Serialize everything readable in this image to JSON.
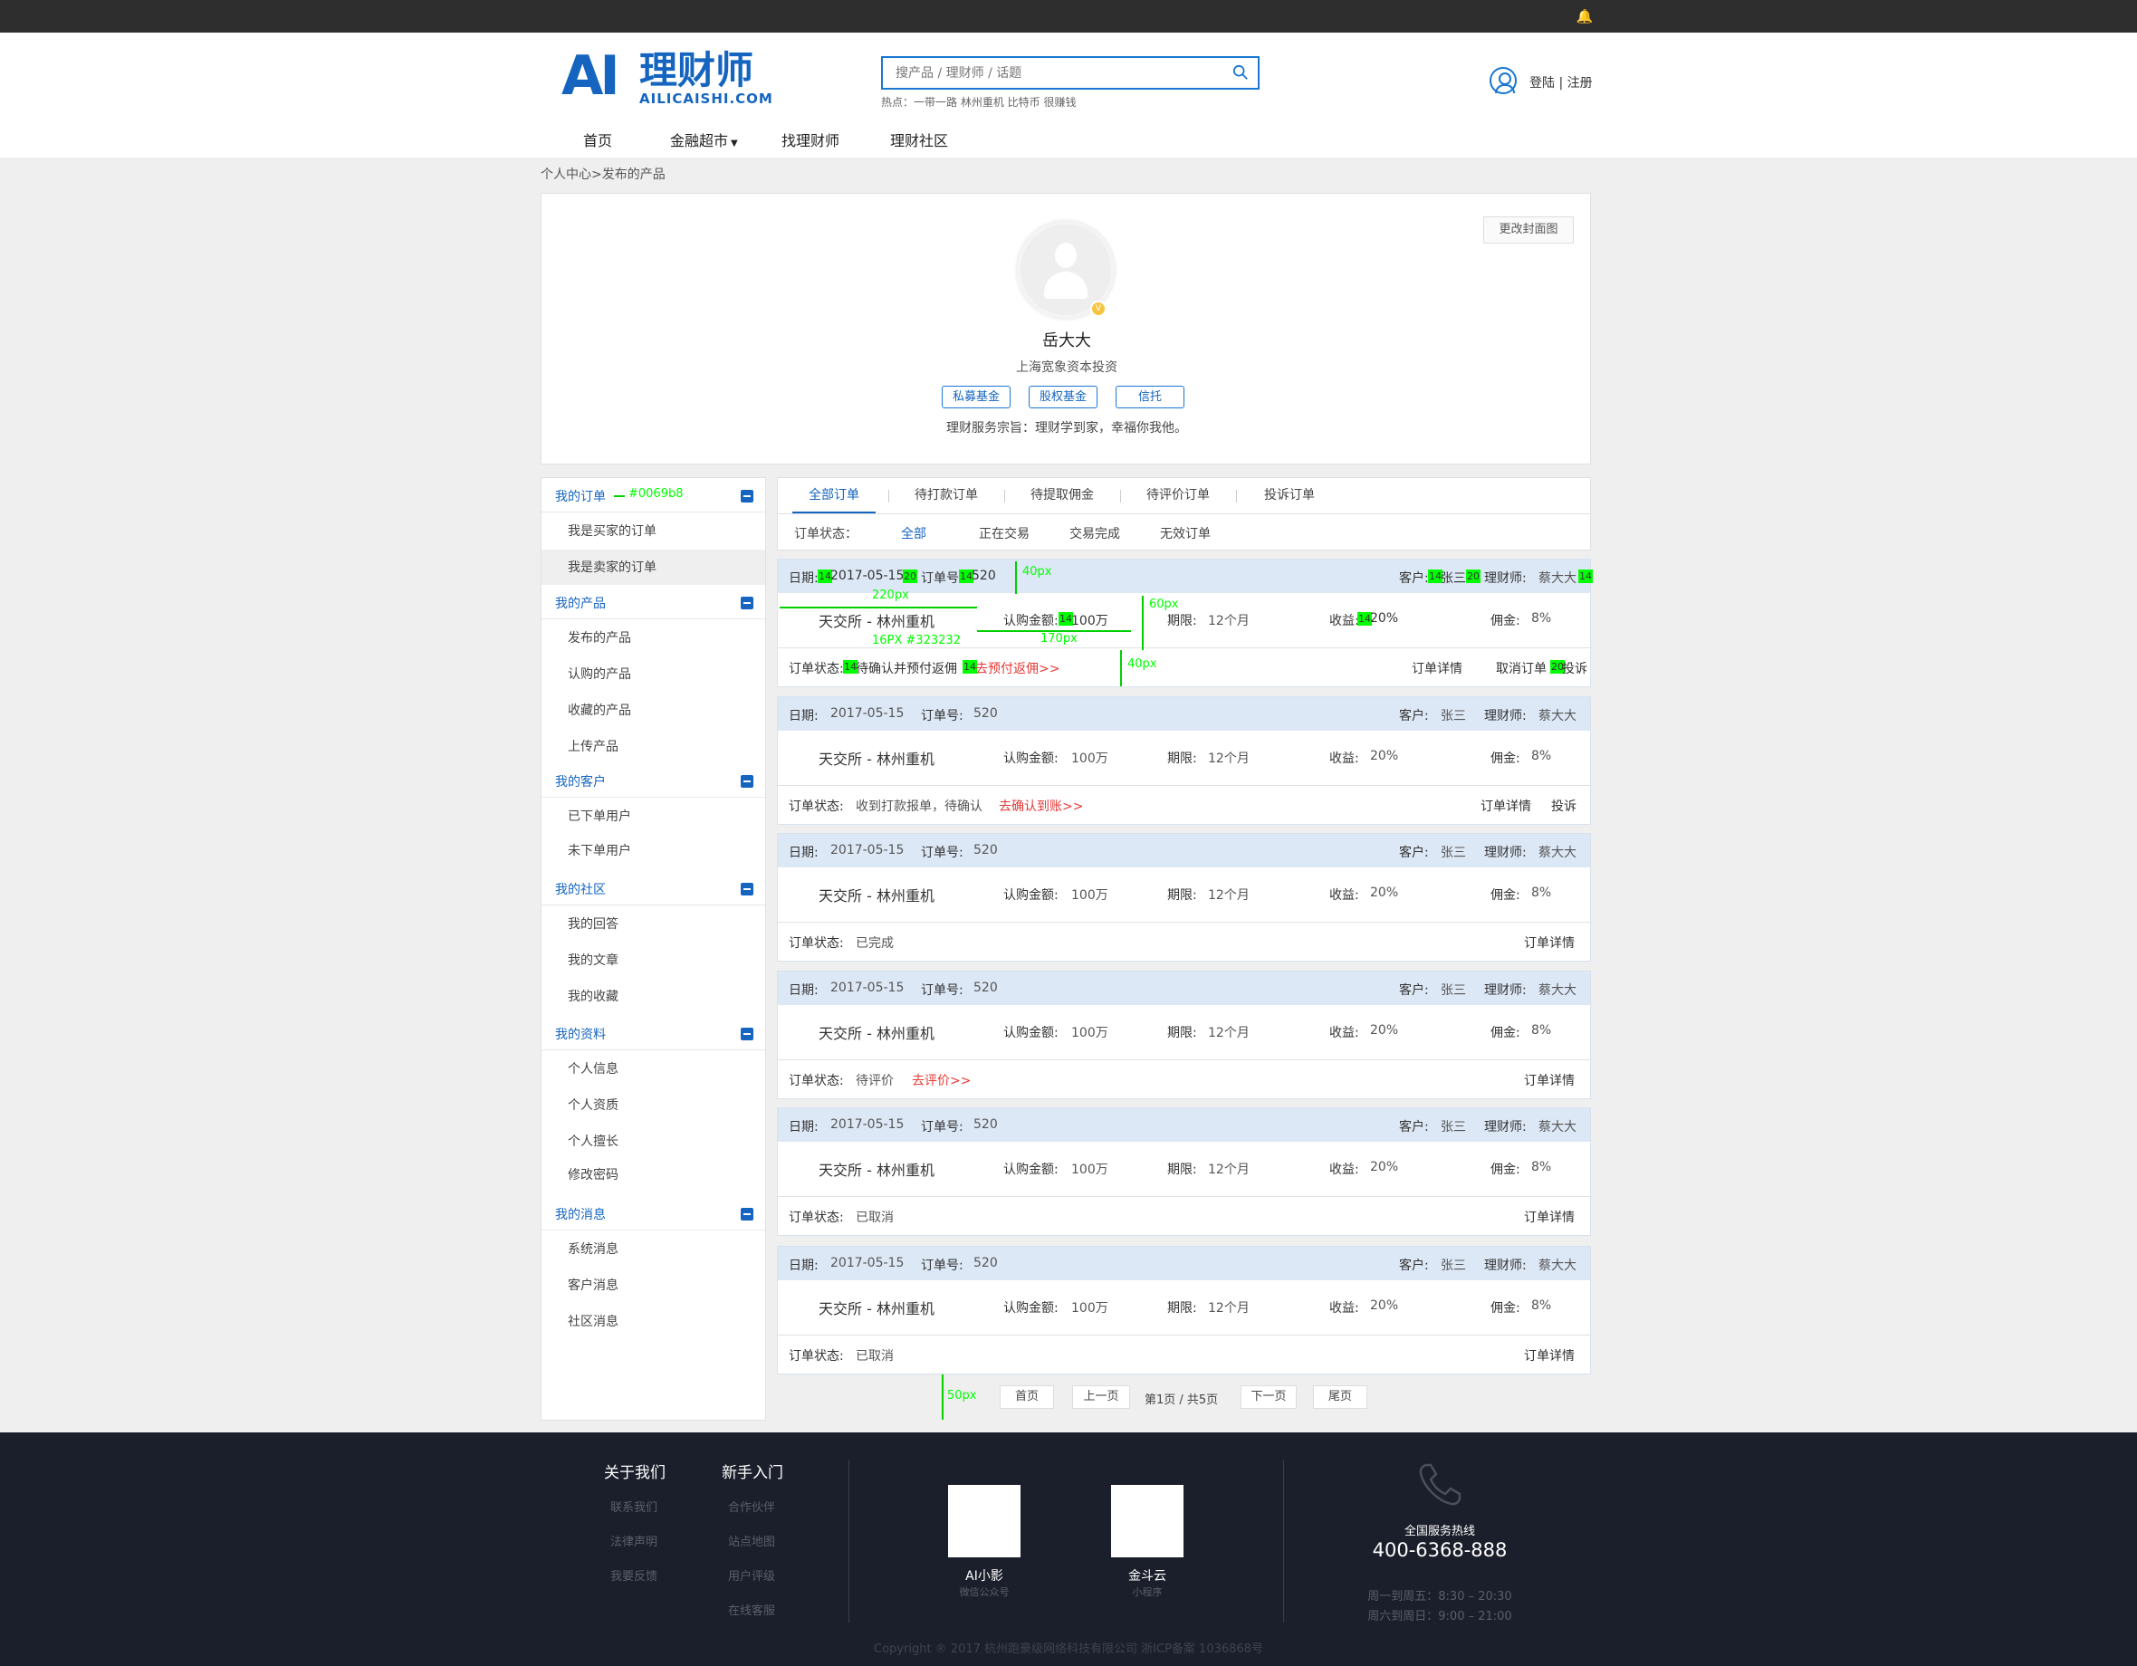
{
  "colors": {
    "brand": "#1565c0",
    "annotation": "#00ff00",
    "link_red": "#e53935",
    "order_header_bg": "#dde8f6",
    "footer_bg": "#1b1f2b"
  },
  "header": {
    "logo_ai": "AI",
    "logo_title": "理财师",
    "logo_sub": "AILICAISHI.COM",
    "search_placeholder": "搜产品 / 理财师 / 话题",
    "hot_label": "热点：一带一路 林州重机 比特币 很赚钱",
    "login": "登陆 | 注册",
    "icons": {
      "notification": "bell-icon",
      "search": "search-icon",
      "user": "user-icon"
    }
  },
  "nav": {
    "items": [
      {
        "label": "首页"
      },
      {
        "label": "金融超市"
      },
      {
        "label": "找理财师"
      },
      {
        "label": "理财社区"
      }
    ]
  },
  "breadcrumb": "个人中心>发布的产品",
  "profile": {
    "cover_button": "更改封面图",
    "name": "岳大大",
    "company": "上海宽象资本投资",
    "tags": [
      "私募基金",
      "股权基金",
      "信托"
    ],
    "motto": "理财服务宗旨：理财学到家，幸福你我他。"
  },
  "sidebar": {
    "groups": [
      {
        "title": "我的订单",
        "items": [
          "我是买家的订单",
          "我是卖家的订单"
        ]
      },
      {
        "title": "我的产品",
        "items": [
          "发布的产品",
          "认购的产品",
          "收藏的产品",
          "上传产品"
        ]
      },
      {
        "title": "我的客户",
        "items": [
          "已下单用户",
          "未下单用户"
        ]
      },
      {
        "title": "我的社区",
        "items": [
          "我的回答",
          "我的文章",
          "我的收藏"
        ]
      },
      {
        "title": "我的资料",
        "items": [
          "个人信息",
          "个人资质",
          "个人擅长",
          "修改密码"
        ]
      },
      {
        "title": "我的消息",
        "items": [
          "系统消息",
          "客户消息",
          "社区消息"
        ]
      }
    ]
  },
  "tabs": [
    "全部订单",
    "待打款订单",
    "待提取佣金",
    "待评价订单",
    "投诉订单"
  ],
  "filter": {
    "label": "订单状态：",
    "options": [
      "全部",
      "正在交易",
      "交易完成",
      "无效订单"
    ]
  },
  "order_labels": {
    "date": "日期:",
    "order_no": "订单号:",
    "customer": "客户:",
    "planner": "理财师:",
    "amount": "认购金额:",
    "term": "期限:",
    "yield": "收益:",
    "commission": "佣金:",
    "status": "订单状态:",
    "detail": "订单详情",
    "cancel": "取消订单",
    "complain": "投诉"
  },
  "orders": [
    {
      "date": "2017-05-15",
      "no": "520",
      "customer": "张三",
      "planner": "蔡大大",
      "product": "天交所 - 林州重机",
      "amount": "100万",
      "term": "12个月",
      "yield": "20%",
      "commission": "8%",
      "status": "待确认并预付返佣",
      "action": "去预付返佣>>",
      "links": [
        "订单详情",
        "取消订单",
        "投诉"
      ]
    },
    {
      "date": "2017-05-15",
      "no": "520",
      "customer": "张三",
      "planner": "蔡大大",
      "product": "天交所 - 林州重机",
      "amount": "100万",
      "term": "12个月",
      "yield": "20%",
      "commission": "8%",
      "status": "收到打款报单，待确认",
      "action": "去确认到账>>",
      "links": [
        "订单详情",
        "投诉"
      ]
    },
    {
      "date": "2017-05-15",
      "no": "520",
      "customer": "张三",
      "planner": "蔡大大",
      "product": "天交所 - 林州重机",
      "amount": "100万",
      "term": "12个月",
      "yield": "20%",
      "commission": "8%",
      "status": "已完成",
      "action": "",
      "links": [
        "订单详情"
      ]
    },
    {
      "date": "2017-05-15",
      "no": "520",
      "customer": "张三",
      "planner": "蔡大大",
      "product": "天交所 - 林州重机",
      "amount": "100万",
      "term": "12个月",
      "yield": "20%",
      "commission": "8%",
      "status": "待评价",
      "action": "去评价>>",
      "links": [
        "订单详情"
      ]
    },
    {
      "date": "2017-05-15",
      "no": "520",
      "customer": "张三",
      "planner": "蔡大大",
      "product": "天交所 - 林州重机",
      "amount": "100万",
      "term": "12个月",
      "yield": "20%",
      "commission": "8%",
      "status": "已取消",
      "action": "",
      "links": [
        "订单详情"
      ]
    },
    {
      "date": "2017-05-15",
      "no": "520",
      "customer": "张三",
      "planner": "蔡大大",
      "product": "天交所 - 林州重机",
      "amount": "100万",
      "term": "12个月",
      "yield": "20%",
      "commission": "8%",
      "status": "已取消",
      "action": "",
      "links": [
        "订单详情"
      ]
    }
  ],
  "annotations": {
    "sidebar_color": "#0069b8",
    "n14": "14",
    "n20": "20",
    "px40": "40px",
    "px220": "220px",
    "px60": "60px",
    "px16": "16PX #323232",
    "px170": "170px",
    "px50": "50px"
  },
  "pager": {
    "first": "首页",
    "prev": "上一页",
    "info": "第1页 / 共5页",
    "next": "下一页",
    "last": "尾页"
  },
  "footer": {
    "col1": {
      "title": "关于我们",
      "links": [
        "联系我们",
        "法律声明",
        "我要反馈"
      ]
    },
    "col2": {
      "title": "新手入门",
      "links": [
        "合作伙伴",
        "站点地图",
        "用户评级",
        "在线客服"
      ]
    },
    "qr1": {
      "name": "AI小影",
      "sub": "微信公众号"
    },
    "qr2": {
      "name": "金斗云",
      "sub": "小程序"
    },
    "hotline_label": "全国服务热线",
    "hotline": "400-6368-888",
    "hours1": "周一到周五：8:30 – 20:30",
    "hours2": "周六到周日：9:00 – 21:00",
    "copyright": "Copyright ® 2017 杭州跑豪级网络科技有限公司 浙ICP备案 1036868号"
  }
}
